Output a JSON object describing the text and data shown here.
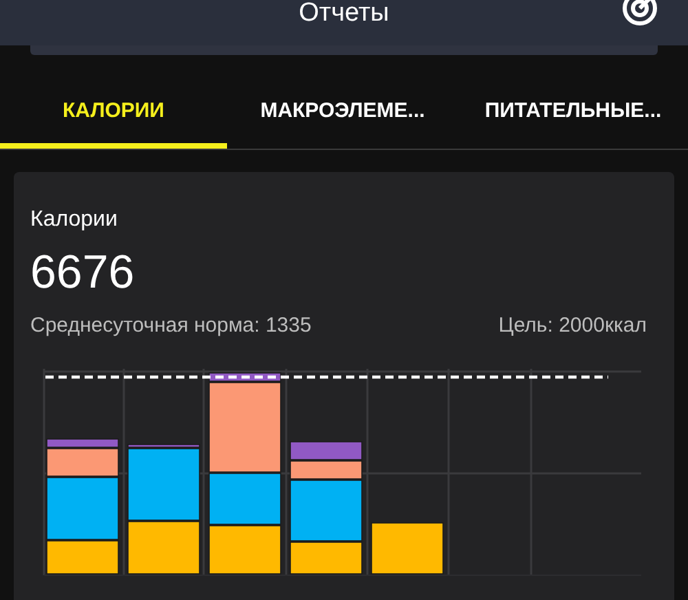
{
  "header": {
    "title": "Отчеты"
  },
  "tabs": [
    {
      "label": "КАЛОРИИ",
      "selected": true
    },
    {
      "label": "МАКРОЭЛЕМЕ...",
      "selected": false
    },
    {
      "label": "ПИТАТЕЛЬНЫЕ...",
      "selected": false
    }
  ],
  "card": {
    "title": "Калории",
    "total": "6676",
    "average": "Среднесуточная норма: 1335",
    "goal": "Цель: 2000ккал"
  }
}
